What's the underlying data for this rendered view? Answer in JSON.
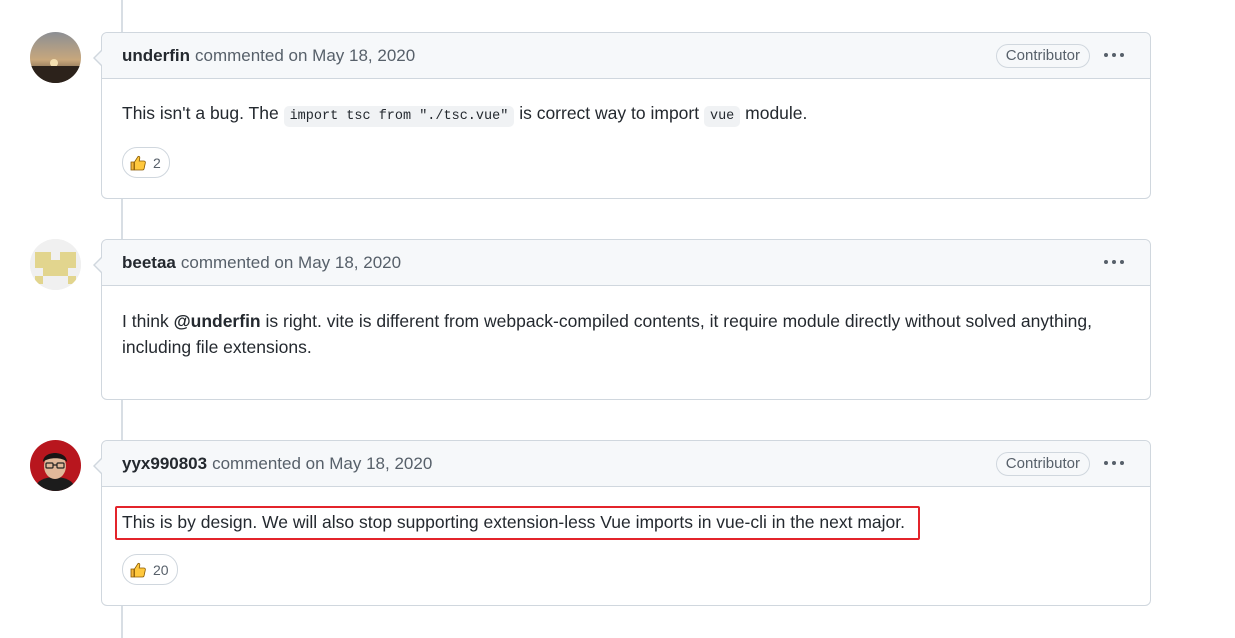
{
  "comments": [
    {
      "author": "underfin",
      "meta": "commented on May 18, 2020",
      "badge": "Contributor",
      "body_parts": [
        "This isn't a bug. The ",
        "import tsc from \"./tsc.vue\"",
        " is correct way to import ",
        "vue",
        " module."
      ],
      "reaction_count": "2"
    },
    {
      "author": "beetaa",
      "meta": "commented on May 18, 2020",
      "body_line1_pre": "I think ",
      "body_mention": "@underfin",
      "body_line1_post": " is right. vite is different from webpack-compiled contents, it require module directly without solved anything,",
      "body_line2": "including file extensions."
    },
    {
      "author": "yyx990803",
      "meta": "commented on May 18, 2020",
      "badge": "Contributor",
      "body": "This is by design. We will also stop supporting extension-less Vue imports in vue-cli in the next major.",
      "reaction_count": "20"
    }
  ],
  "icons": {
    "more": "kebab-horizontal-icon",
    "reaction": "thumbs-up-icon"
  },
  "colors": {
    "highlight_box": "#e3242b",
    "header_bg": "#f6f8fa",
    "border": "#d0d7de"
  }
}
